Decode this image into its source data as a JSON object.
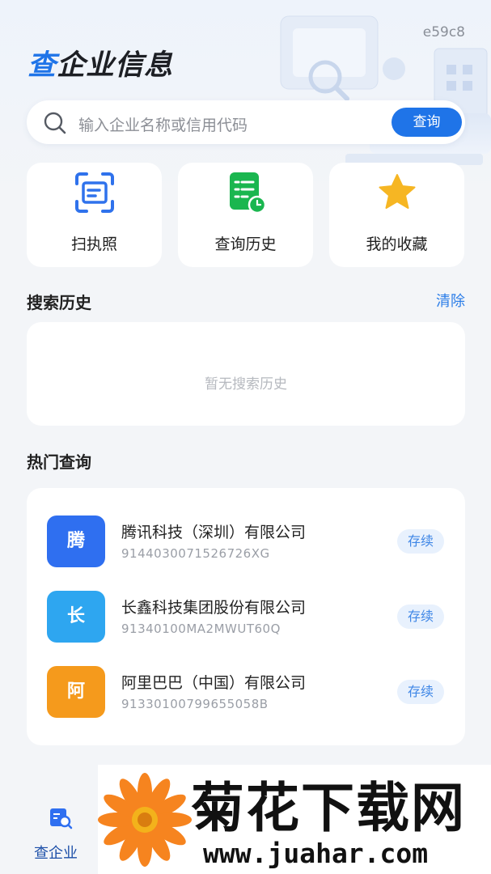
{
  "app_id": "e59c8",
  "title": {
    "accent": "查",
    "rest": "企业信息"
  },
  "search": {
    "placeholder": "输入企业名称或信用代码",
    "button": "查询"
  },
  "quick_actions": [
    {
      "label": "扫执照",
      "icon": "scan-license-icon"
    },
    {
      "label": "查询历史",
      "icon": "history-list-icon"
    },
    {
      "label": "我的收藏",
      "icon": "star-icon"
    }
  ],
  "history": {
    "title": "搜索历史",
    "clear": "清除",
    "empty_text": "暂无搜索历史"
  },
  "hot": {
    "title": "热门查询",
    "items": [
      {
        "avatar": "腾",
        "name": "腾讯科技（深圳）有限公司",
        "code": "9144030071526726XG",
        "status": "存续",
        "color": "#2f6ff0"
      },
      {
        "avatar": "长",
        "name": "长鑫科技集团股份有限公司",
        "code": "91340100MA2MWUT60Q",
        "status": "存续",
        "color": "#2ea6f0"
      },
      {
        "avatar": "阿",
        "name": "阿里巴巴（中国）有限公司",
        "code": "91330100799655058B",
        "status": "存续",
        "color": "#f59a1c"
      }
    ]
  },
  "tabbar": {
    "label": "查企业",
    "icon": "company-search-icon"
  },
  "watermark": {
    "title": "菊花下载网",
    "url": "www.juahar.com"
  },
  "colors": {
    "primary": "#1f74e8",
    "background": "#f3f5f8"
  }
}
